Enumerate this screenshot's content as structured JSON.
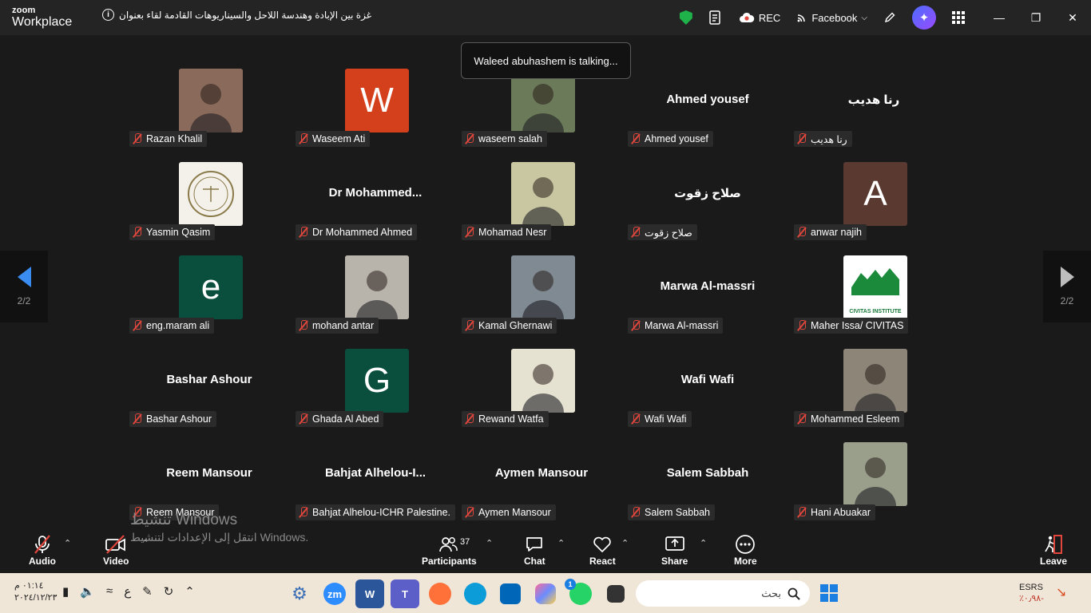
{
  "app": {
    "brand_top": "zoom",
    "brand_bottom": "Workplace",
    "meeting_title": "غزة بين الإبادة وهندسة اللاحل والسيناريوهات القادمة لقاء بعنوان",
    "rec_label": "REC",
    "stream_label": "Facebook"
  },
  "toast": {
    "text": "Waleed abuhashem is talking..."
  },
  "pagination": {
    "left": "2/2",
    "right": "2/2"
  },
  "participants": [
    {
      "label": "Razan Khalil",
      "kind": "photo",
      "color": "#8a6a5a"
    },
    {
      "label": "Waseem Ati",
      "kind": "letter",
      "letter": "W",
      "color": "#d4401c"
    },
    {
      "label": "waseem salah",
      "kind": "photo",
      "color": "#6b7a58"
    },
    {
      "label": "Ahmed yousef",
      "kind": "name",
      "display": "Ahmed yousef"
    },
    {
      "label": "رنا هديب",
      "kind": "name",
      "display": "رنا هديب"
    },
    {
      "label": "Yasmin Qasim",
      "kind": "logo",
      "color": "#f4f1ea"
    },
    {
      "label": "Dr Mohammed Ahmed",
      "kind": "name",
      "display": "Dr  Mohammed..."
    },
    {
      "label": "Mohamad Nesr",
      "kind": "photo",
      "color": "#c9c7a2"
    },
    {
      "label": "صلاح زقوت",
      "kind": "name",
      "display": "صلاح زقوت"
    },
    {
      "label": "anwar najih",
      "kind": "letter",
      "letter": "A",
      "color": "#5a3a30"
    },
    {
      "label": "eng.maram ali",
      "kind": "letter",
      "letter": "e",
      "color": "#0a4f3e"
    },
    {
      "label": "mohand antar",
      "kind": "photo",
      "color": "#b9b4ab"
    },
    {
      "label": "Kamal Ghernawi",
      "kind": "photo",
      "color": "#7f8a92"
    },
    {
      "label": "Marwa Al-massri",
      "kind": "name",
      "display": "Marwa Al-massri"
    },
    {
      "label": "Maher Issa/ CIVITAS",
      "kind": "logo",
      "color": "#ffffff",
      "logo_text": "CIVITAS INSTITUTE"
    },
    {
      "label": "Bashar Ashour",
      "kind": "name",
      "display": "Bashar Ashour"
    },
    {
      "label": "Ghada Al Abed",
      "kind": "letter",
      "letter": "G",
      "color": "#0a4f3e"
    },
    {
      "label": "Rewand Watfa",
      "kind": "photo",
      "color": "#e6e2d2"
    },
    {
      "label": "Wafi Wafi",
      "kind": "name",
      "display": "Wafi Wafi"
    },
    {
      "label": "Mohammed Esleem",
      "kind": "photo",
      "color": "#8c8578"
    },
    {
      "label": "Reem Mansour",
      "kind": "name",
      "display": "Reem Mansour"
    },
    {
      "label": "Bahjat Alhelou-ICHR Palestine.",
      "kind": "name",
      "display": "Bahjat  Alhelou-I..."
    },
    {
      "label": "Aymen Mansour",
      "kind": "name",
      "display": "Aymen Mansour"
    },
    {
      "label": "Salem Sabbah",
      "kind": "name",
      "display": "Salem Sabbah"
    },
    {
      "label": "Hani Abuakar",
      "kind": "photo",
      "color": "#9a9f8c"
    }
  ],
  "watermark": {
    "line1": "تنشيط Windows",
    "line2": "انتقل إلى الإعدادات لتنشيط Windows."
  },
  "toolbar": {
    "audio": "Audio",
    "video": "Video",
    "participants": "Participants",
    "participants_count": "37",
    "chat": "Chat",
    "react": "React",
    "share": "Share",
    "more": "More",
    "leave": "Leave"
  },
  "taskbar": {
    "time": "٠١:١٤ م",
    "date": "٢٠٢٤/١٢/٢٣",
    "lang": "ع",
    "search_placeholder": "بحث",
    "stock_name": "ESRS",
    "stock_change": "٪٠٫٩٨-",
    "whatsapp_badge": "1"
  }
}
